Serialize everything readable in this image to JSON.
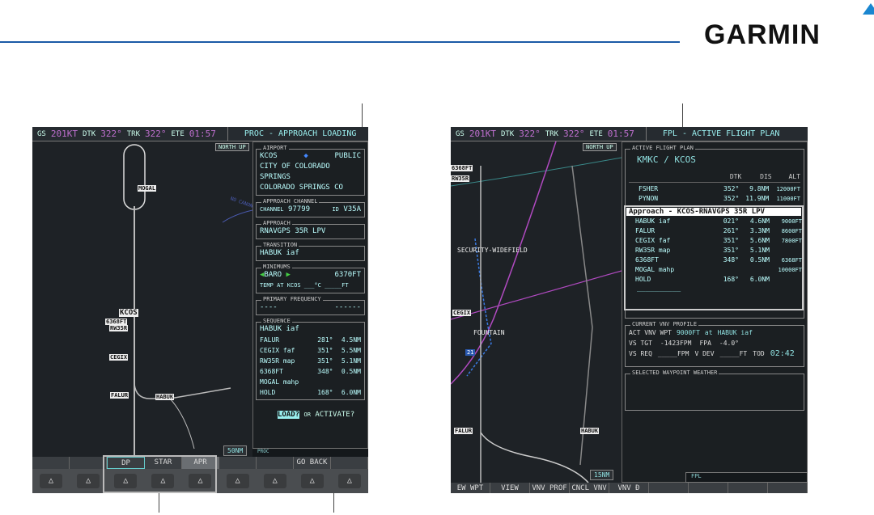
{
  "brand": "GARMIN",
  "left": {
    "topbar": {
      "gs_label": "GS",
      "gs": "201KT",
      "dtk_label": "DTK",
      "dtk": "322°",
      "trk_label": "TRK",
      "trk": "322°",
      "ete_label": "ETE",
      "ete": "01:57",
      "title": "PROC - APPROACH LOADING"
    },
    "map": {
      "orientation": "NORTH UP",
      "range": "50NM",
      "labels": [
        "MOGAL",
        "KCOS",
        "6368FT",
        "RW35R",
        "CEGIX",
        "FALUR",
        "HABUK",
        "NO CANON"
      ]
    },
    "airport": {
      "label": "AIRPORT",
      "id": "KCOS",
      "type": "PUBLIC",
      "city": "CITY OF COLORADO SPRINGS",
      "location": "COLORADO SPRINGS CO"
    },
    "channel": {
      "label": "APPROACH CHANNEL",
      "channel_label": "CHANNEL",
      "channel": "97799",
      "id_label": "ID",
      "id": "V35A"
    },
    "approach": {
      "label": "APPROACH",
      "value": "RNAVGPS 35R LPV"
    },
    "transition": {
      "label": "TRANSITION",
      "value": "HABUK iaf"
    },
    "minimums": {
      "label": "MINIMUMS",
      "mode": "BARO",
      "value": "6370FT",
      "temp": "TEMP AT KCOS ___°C  _____FT"
    },
    "frequency": {
      "label": "PRIMARY FREQUENCY",
      "left": "----",
      "right": "------"
    },
    "sequence": {
      "label": "SEQUENCE",
      "first": "HABUK iaf",
      "rows": [
        {
          "wpt": "FALUR",
          "dtk": "281°",
          "dis": "4.5NM"
        },
        {
          "wpt": "CEGIX faf",
          "dtk": "351°",
          "dis": "5.5NM"
        },
        {
          "wpt": "RW35R map",
          "dtk": "351°",
          "dis": "5.1NM"
        },
        {
          "wpt": "6368FT",
          "dtk": "348°",
          "dis": "0.5NM"
        },
        {
          "wpt": "MOGAL mahp",
          "dtk": "",
          "dis": ""
        },
        {
          "wpt": "HOLD",
          "dtk": "168°",
          "dis": "6.0NM"
        }
      ]
    },
    "prompt": {
      "load": "LOAD?",
      "or": "OR",
      "activate": "ACTIVATE?"
    },
    "status": "PROC",
    "softkeys": [
      "",
      "",
      "DP",
      "STAR",
      "APR",
      "",
      "",
      "GO BACK",
      ""
    ]
  },
  "right": {
    "topbar": {
      "gs_label": "GS",
      "gs": "201KT",
      "dtk_label": "DTK",
      "dtk": "322°",
      "trk_label": "TRK",
      "trk": "322°",
      "ete_label": "ETE",
      "ete": "01:57",
      "title": "FPL - ACTIVE FLIGHT PLAN"
    },
    "map": {
      "orientation": "NORTH UP",
      "range": "15NM",
      "labels": [
        "SECURITY-WIDEFIELD",
        "CEGIX",
        "FOUNTAIN",
        "FALUR",
        "HABUK",
        "RW35R",
        "6368FT",
        "21"
      ]
    },
    "fpl": {
      "label": "ACTIVE FLIGHT PLAN",
      "route": "KMKC / KCOS",
      "headers": [
        "DTK",
        "DIS",
        "ALT"
      ],
      "enroute": [
        {
          "wpt": "FSHER",
          "dtk": "352°",
          "dis": "9.8NM",
          "alt": "12000FT"
        },
        {
          "wpt": "PYNON",
          "dtk": "352°",
          "dis": "11.9NM",
          "alt": "11000FT"
        }
      ],
      "approach_header": "Approach - KCOS-RNAVGPS 35R LPV",
      "approach": [
        {
          "wpt": "HABUK iaf",
          "dtk": "021°",
          "dis": "4.6NM",
          "alt": "9000FT"
        },
        {
          "wpt": "FALUR",
          "dtk": "261°",
          "dis": "3.3NM",
          "alt": "8600FT"
        },
        {
          "wpt": "CEGIX faf",
          "dtk": "351°",
          "dis": "5.6NM",
          "alt": "7800FT"
        },
        {
          "wpt": "RW35R map",
          "dtk": "351°",
          "dis": "5.1NM",
          "alt": ""
        },
        {
          "wpt": "6368FT",
          "dtk": "348°",
          "dis": "0.5NM",
          "alt": "6368FT"
        },
        {
          "wpt": "MOGAL mahp",
          "dtk": "",
          "dis": "",
          "alt": "10000FT"
        },
        {
          "wpt": "HOLD",
          "dtk": "168°",
          "dis": "6.0NM",
          "alt": ""
        }
      ],
      "blank": "__________"
    },
    "vnv": {
      "label": "CURRENT VNV PROFILE",
      "act": "ACT VNV WPT",
      "alt": "9000FT",
      "at": "at",
      "wpt": "HABUK iaf",
      "vs_tgt_label": "VS TGT",
      "vs_tgt": "-1423FPM",
      "fpa_label": "FPA",
      "fpa": "-4.0°",
      "vs_req_label": "VS REQ",
      "vs_req": "_____FPM",
      "vdev_label": "V DEV",
      "vdev": "_____FT",
      "tod_label": "TOD",
      "tod": "02:42"
    },
    "weather": {
      "label": "SELECTED WAYPOINT WEATHER"
    },
    "status": "FPL",
    "softkeys": [
      "EW WPT",
      "VIEW",
      "VNV PROF",
      "CNCL VNV",
      "VNV Đ",
      "",
      "",
      "",
      ""
    ]
  }
}
